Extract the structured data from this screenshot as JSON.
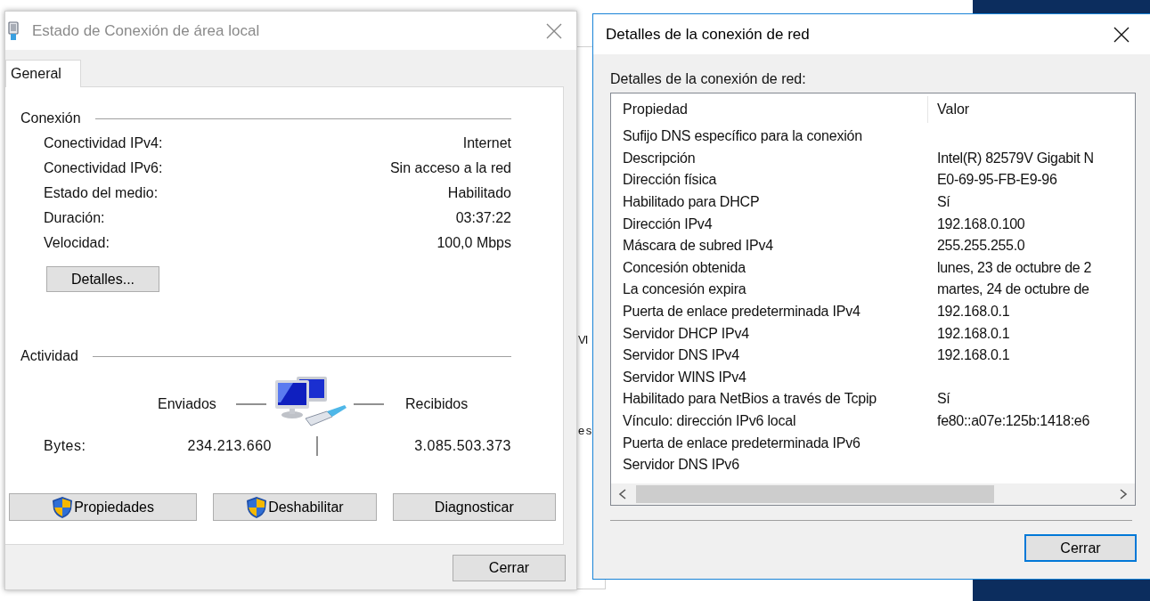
{
  "background": {
    "fragments": [
      "VI",
      "e s"
    ]
  },
  "status_window": {
    "title": "Estado de Conexión de área local",
    "active": false,
    "tabs": [
      {
        "label": "General",
        "selected": true
      }
    ],
    "connection": {
      "title": "Conexión",
      "fields": [
        {
          "label": "Conectividad IPv4:",
          "value": "Internet"
        },
        {
          "label": "Conectividad IPv6:",
          "value": "Sin acceso a la red"
        },
        {
          "label": "Estado del medio:",
          "value": "Habilitado"
        },
        {
          "label": "Duración:",
          "value": "03:37:22"
        },
        {
          "label": "Velocidad:",
          "value": "100,0 Mbps"
        }
      ],
      "button": "Detalles..."
    },
    "activity": {
      "title": "Actividad",
      "sent_label": "Enviados",
      "received_label": "Recibidos",
      "bytes_label": "Bytes:",
      "sent": "234.213.660",
      "received": "3.085.503.373"
    },
    "actions": [
      {
        "label": "Propiedades",
        "shield": true
      },
      {
        "label": "Deshabilitar",
        "shield": true
      },
      {
        "label": "Diagnosticar",
        "shield": false
      }
    ],
    "close_button": "Cerrar"
  },
  "details_window": {
    "title": "Detalles de la conexión de red",
    "active": true,
    "caption": "Detalles de la conexión de red:",
    "columns": [
      "Propiedad",
      "Valor"
    ],
    "rows": [
      {
        "property": "Sufijo DNS específico para la conexión",
        "value": ""
      },
      {
        "property": "Descripción",
        "value": "Intel(R) 82579V Gigabit N"
      },
      {
        "property": "Dirección física",
        "value": "E0-69-95-FB-E9-96"
      },
      {
        "property": "Habilitado para DHCP",
        "value": "Sí"
      },
      {
        "property": "Dirección IPv4",
        "value": "192.168.0.100"
      },
      {
        "property": "Máscara de subred IPv4",
        "value": "255.255.255.0"
      },
      {
        "property": "Concesión obtenida",
        "value": "lunes, 23 de octubre de 2"
      },
      {
        "property": "La concesión expira",
        "value": "martes, 24 de octubre de"
      },
      {
        "property": "Puerta de enlace predeterminada IPv4",
        "value": "192.168.0.1"
      },
      {
        "property": "Servidor DHCP IPv4",
        "value": "192.168.0.1"
      },
      {
        "property": "Servidor DNS IPv4",
        "value": "192.168.0.1"
      },
      {
        "property": "Servidor WINS IPv4",
        "value": ""
      },
      {
        "property": "Habilitado para NetBios a través de Tcpip",
        "value": "Sí"
      },
      {
        "property": "Vínculo: dirección IPv6 local",
        "value": "fe80::a07e:125b:1418:e6"
      },
      {
        "property": "Puerta de enlace predeterminada IPv6",
        "value": ""
      },
      {
        "property": "Servidor DNS IPv6",
        "value": ""
      }
    ],
    "close_button": {
      "label": "Cerrar",
      "default": true
    }
  }
}
